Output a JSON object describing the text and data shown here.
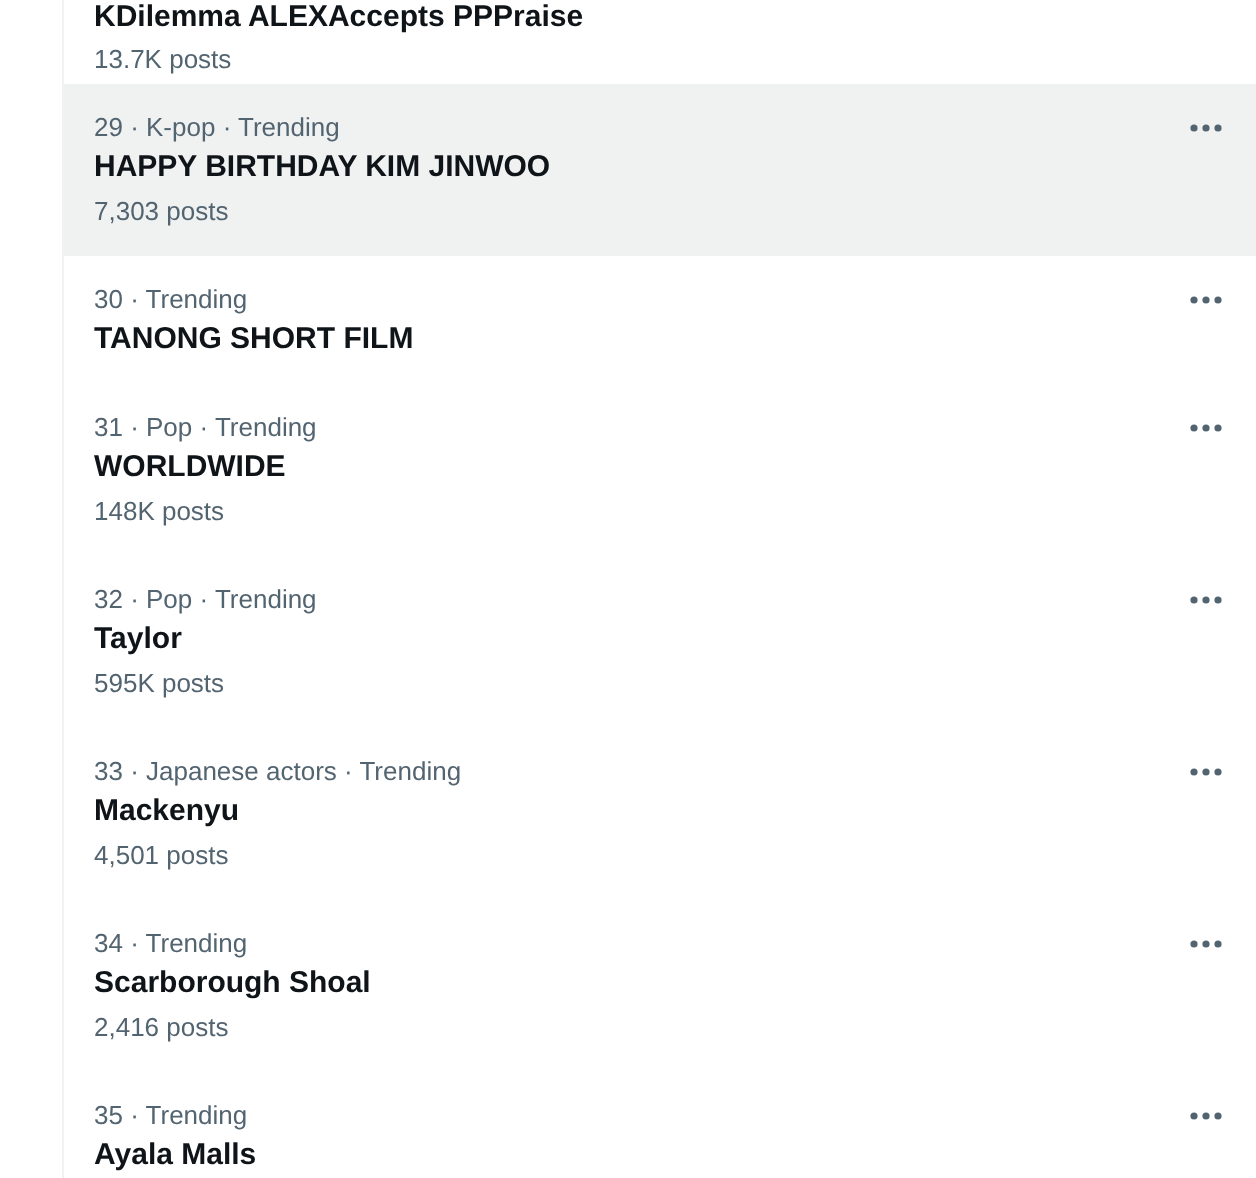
{
  "trends": [
    {
      "title": "KDilemma ALEXAccepts PPPraise",
      "posts": "13.7K posts",
      "highlighted": false
    },
    {
      "meta": "29 · K-pop · Trending",
      "title": "HAPPY BIRTHDAY KIM JINWOO",
      "posts": "7,303 posts",
      "highlighted": true
    },
    {
      "meta": "30 · Trending",
      "title": "TANONG SHORT FILM",
      "highlighted": false
    },
    {
      "meta": "31 · Pop · Trending",
      "title": "WORLDWIDE",
      "posts": "148K posts",
      "highlighted": false
    },
    {
      "meta": "32 · Pop · Trending",
      "title": "Taylor",
      "posts": "595K posts",
      "highlighted": false
    },
    {
      "meta": "33 · Japanese actors · Trending",
      "title": "Mackenyu",
      "posts": "4,501 posts",
      "highlighted": false
    },
    {
      "meta": "34 · Trending",
      "title": "Scarborough Shoal",
      "posts": "2,416 posts",
      "highlighted": false
    },
    {
      "meta": "35 · Trending",
      "title": "Ayala Malls",
      "highlighted": false
    }
  ]
}
